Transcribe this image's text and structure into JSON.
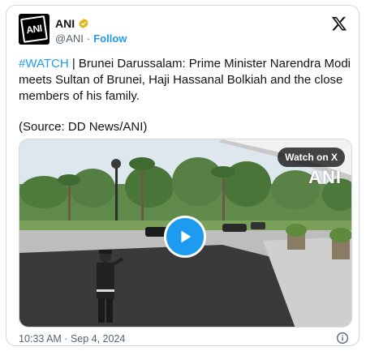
{
  "author": {
    "name": "ANI",
    "handle": "@ANI",
    "follow_label": "Follow",
    "avatar_text": "ANI",
    "verified_color": "#e2b719"
  },
  "tweet": {
    "hashtag": "#WATCH",
    "body": " | Brunei Darussalam: Prime Minister Narendra Modi meets Sultan of Brunei, Haji Hassanal Bolkiah and the close members of his family.",
    "source": "(Source: DD News/ANI)"
  },
  "video": {
    "watch_label": "Watch on X",
    "watermark": "ANI",
    "play_color": "#1d9bf0"
  },
  "meta": {
    "timestamp": "10:33 AM · Sep 4, 2024"
  },
  "icons": [
    "x-logo-icon",
    "verified-badge-icon",
    "play-icon",
    "info-icon"
  ]
}
